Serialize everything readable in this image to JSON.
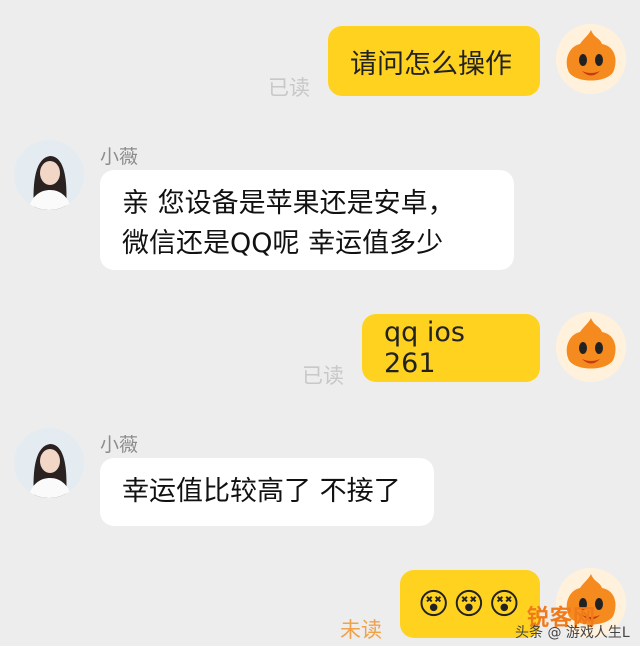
{
  "messages": [
    {
      "side": "right",
      "text": "请问怎么操作",
      "status": "已读"
    },
    {
      "side": "left",
      "sender": "小薇",
      "lines": [
        "亲 您设备是苹果还是安卓，",
        "微信还是QQ呢  幸运值多少"
      ]
    },
    {
      "side": "right",
      "text": "qq ios 261",
      "status": "已读"
    },
    {
      "side": "left",
      "sender": "小薇",
      "lines": [
        "幸运值比较高了 不接了"
      ]
    },
    {
      "side": "right",
      "emojis": [
        "😵",
        "😵",
        "😵"
      ],
      "status": "未读"
    }
  ],
  "watermark": {
    "main": "锐客网",
    "sub": "头条 @ 游戏人生L"
  },
  "colors": {
    "background": "#ededed",
    "self_bubble": "#ffd21f",
    "other_bubble": "#ffffff",
    "unread": "#f0a14a",
    "brand": "#f07a1a"
  },
  "icons": {
    "self_avatar": "orange-mascot-avatar-icon",
    "other_avatar": "girl-portrait-avatar-icon"
  }
}
